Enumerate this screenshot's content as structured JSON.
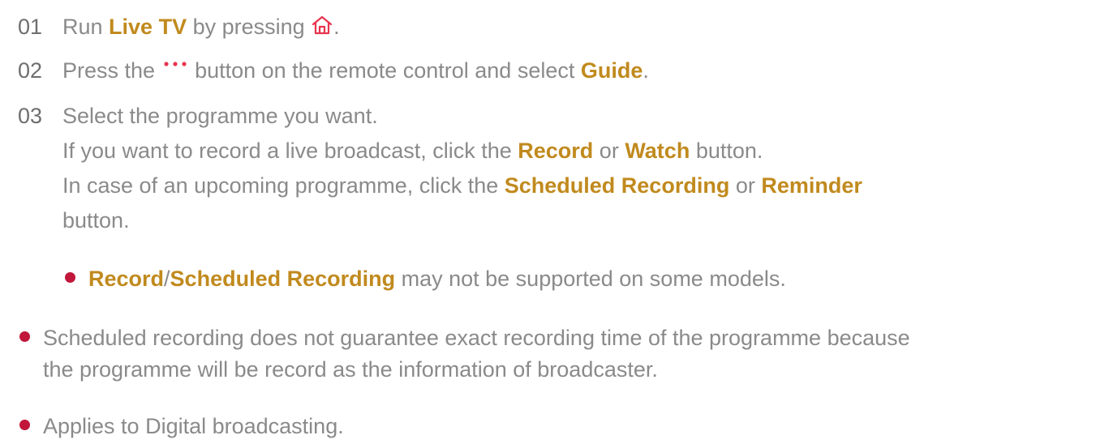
{
  "steps": [
    {
      "number": "01",
      "text_a": "Run ",
      "bold_a": "Live TV",
      "text_b": " by pressing ",
      "icon": "home-icon",
      "text_c": "."
    },
    {
      "number": "02",
      "text_a": "Press the ",
      "icon": "more-dots-icon",
      "text_b": " button on the remote control and select ",
      "bold_a": "Guide",
      "text_c": "."
    },
    {
      "number": "03",
      "line1": "Select the programme you want.",
      "line2_a": "If you want to record a live broadcast, click the ",
      "line2_bold_a": "Record",
      "line2_b": " or ",
      "line2_bold_b": "Watch",
      "line2_c": " button.",
      "line3_a": "In case of an upcoming programme, click the ",
      "line3_bold_a": "Scheduled Recording",
      "line3_b": " or ",
      "line3_bold_b": "Reminder",
      "line4": "button.",
      "sub_note": {
        "bold_a": "Record",
        "sep": "/",
        "bold_b": "Scheduled Recording",
        "text": " may not be supported on some models."
      }
    }
  ],
  "notes": [
    {
      "line1": "Scheduled recording does not guarantee exact recording time of the programme because",
      "line2": "the programme will be record as the information of broadcaster."
    },
    {
      "line1": "Applies to Digital broadcasting."
    }
  ],
  "colors": {
    "highlight": "#c18a1e",
    "bullet": "#c0173a",
    "icon": "#e8344e",
    "text": "#8a8a8a"
  }
}
